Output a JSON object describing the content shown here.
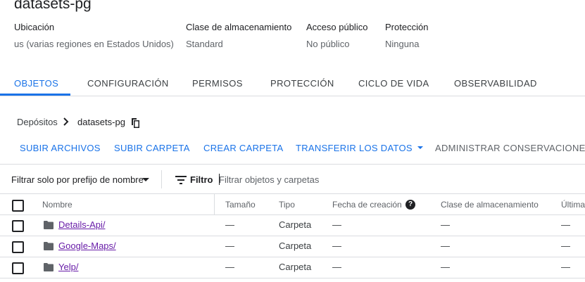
{
  "bucket": {
    "title": "datasets-pg",
    "info": [
      {
        "label": "Ubicación",
        "value": "us (varias regiones en Estados Unidos)"
      },
      {
        "label": "Clase de almacenamiento",
        "value": "Standard"
      },
      {
        "label": "Acceso público",
        "value": "No público"
      },
      {
        "label": "Protección",
        "value": "Ninguna"
      }
    ]
  },
  "tabs": [
    {
      "label": "OBJETOS",
      "active": true
    },
    {
      "label": "CONFIGURACIÓN",
      "active": false
    },
    {
      "label": "PERMISOS",
      "active": false
    },
    {
      "label": "PROTECCIÓN",
      "active": false
    },
    {
      "label": "CICLO DE VIDA",
      "active": false
    },
    {
      "label": "OBSERVABILIDAD",
      "active": false
    }
  ],
  "breadcrumb": {
    "root": "Depósitos",
    "current": "datasets-pg"
  },
  "actions": [
    "SUBIR ARCHIVOS",
    "SUBIR CARPETA",
    "CREAR CARPETA",
    "TRANSFERIR LOS DATOS",
    "ADMINISTRAR CONSERVACIONES"
  ],
  "filter": {
    "prefix_label": "Filtrar solo por prefijo de nombre",
    "filter_label": "Filtro",
    "placeholder": "Filtrar objetos y carpetas"
  },
  "table": {
    "headers": [
      "Nombre",
      "Tamaño",
      "Tipo",
      "Fecha de creación",
      "Clase de almacenamiento",
      "Última"
    ],
    "rows": [
      {
        "name": "Details-Api/",
        "size": "—",
        "type": "Carpeta",
        "created": "—",
        "storage_class": "—",
        "last": "—"
      },
      {
        "name": "Google-Maps/",
        "size": "—",
        "type": "Carpeta",
        "created": "—",
        "storage_class": "—",
        "last": "—"
      },
      {
        "name": "Yelp/",
        "size": "—",
        "type": "Carpeta",
        "created": "—",
        "storage_class": "—",
        "last": "—"
      }
    ]
  },
  "colors": {
    "accent": "#1a73e8",
    "link_visited": "#681da8",
    "divider": "#dadce0"
  },
  "icons": [
    "chevron-right-icon",
    "copy-icon",
    "caret-down-icon",
    "filter-icon",
    "help-icon",
    "folder-icon",
    "checkbox"
  ]
}
